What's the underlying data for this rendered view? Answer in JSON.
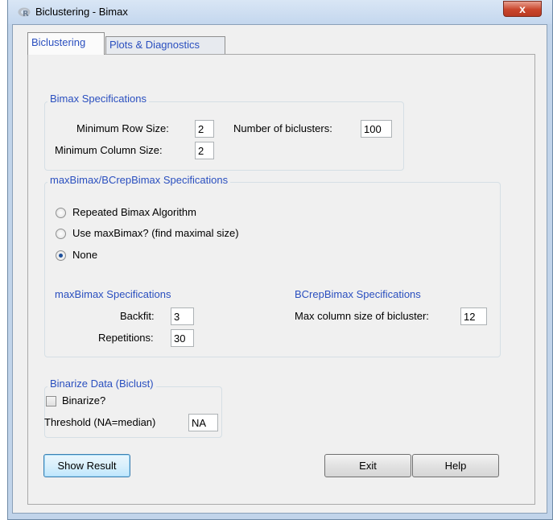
{
  "window": {
    "title": "Biclustering - Bimax",
    "close_label": "x"
  },
  "tabs": [
    "Biclustering",
    "Plots & Diagnostics"
  ],
  "bimax": {
    "group_label": "Bimax Specifications",
    "min_row_label": "Minimum Row Size:",
    "min_row_value": "2",
    "min_col_label": "Minimum Column Size:",
    "min_col_value": "2",
    "num_biclusters_label": "Number of biclusters:",
    "num_biclusters_value": "100"
  },
  "maxbimax": {
    "group_label": "maxBimax/BCrepBimax Specifications",
    "radio_options": [
      "Repeated Bimax Algorithm",
      "Use maxBimax? (find maximal size)",
      "None"
    ],
    "selected_option": "None",
    "maxbimax_spec_label": "maxBimax Specifications",
    "backfit_label": "Backfit:",
    "backfit_value": "3",
    "repetitions_label": "Repetitions:",
    "repetitions_value": "30",
    "bcrep_spec_label": "BCrepBimax Specifications",
    "max_col_label": "Max column size of bicluster:",
    "max_col_value": "12"
  },
  "binarize": {
    "group_label": "Binarize Data (Biclust)",
    "checkbox_label": "Binarize?",
    "checked": false,
    "threshold_label": "Threshold (NA=median)",
    "threshold_value": "NA"
  },
  "buttons": {
    "show_result": "Show Result",
    "exit": "Exit",
    "help": "Help"
  }
}
